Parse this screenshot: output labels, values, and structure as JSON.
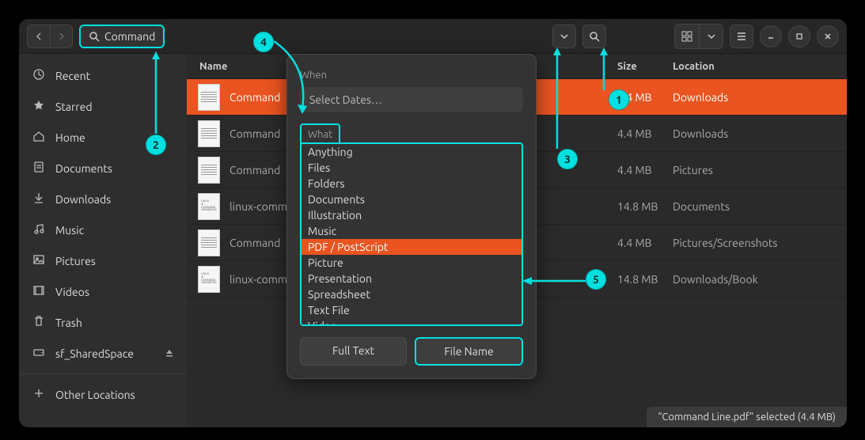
{
  "header": {
    "search_query": "Command"
  },
  "sidebar": {
    "items": [
      {
        "icon": "clock",
        "label": "Recent"
      },
      {
        "icon": "star",
        "label": "Starred"
      },
      {
        "icon": "home",
        "label": "Home"
      },
      {
        "icon": "doc",
        "label": "Documents"
      },
      {
        "icon": "down",
        "label": "Downloads"
      },
      {
        "icon": "music",
        "label": "Music"
      },
      {
        "icon": "pic",
        "label": "Pictures"
      },
      {
        "icon": "video",
        "label": "Videos"
      },
      {
        "icon": "trash",
        "label": "Trash"
      }
    ],
    "mount": {
      "icon": "disk",
      "label": "sf_SharedSpace"
    },
    "other": {
      "icon": "plus",
      "label": "Other Locations"
    }
  },
  "columns": {
    "name": "Name",
    "size": "Size",
    "location": "Location"
  },
  "files": [
    {
      "name": "Command",
      "size": "4.4 MB",
      "location": "Downloads",
      "selected": true,
      "thumb": "pdf"
    },
    {
      "name": "Command",
      "size": "4.4 MB",
      "location": "Downloads",
      "thumb": "pdf"
    },
    {
      "name": "Command",
      "size": "4.4 MB",
      "location": "Pictures",
      "thumb": "pdf"
    },
    {
      "name": "linux-comm",
      "size": "14.8 MB",
      "location": "Documents",
      "thumb": "linux"
    },
    {
      "name": "Command",
      "size": "4.4 MB",
      "location": "Pictures/Screenshots",
      "thumb": "pdf"
    },
    {
      "name": "linux-comm",
      "size": "14.8 MB",
      "location": "Downloads/Book",
      "thumb": "linux"
    }
  ],
  "popover": {
    "when_label": "When",
    "date_placeholder": "Select Dates…",
    "what_label": "What",
    "types": [
      "Anything",
      "Files",
      "Folders",
      "Documents",
      "Illustration",
      "Music",
      "PDF / PostScript",
      "Picture",
      "Presentation",
      "Spreadsheet",
      "Text File",
      "Video"
    ],
    "selected_type": "PDF / PostScript",
    "mode_fulltext": "Full Text",
    "mode_filename": "File Name"
  },
  "status": "“Command Line.pdf” selected  (4.4 MB)",
  "annotations": [
    "1",
    "2",
    "3",
    "4",
    "5"
  ],
  "accent": "#e95420",
  "highlight": "#00e0e0"
}
